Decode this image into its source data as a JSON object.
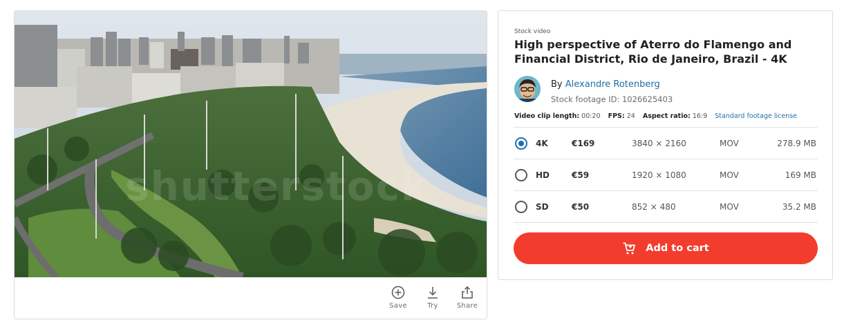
{
  "media": {
    "watermark": "shutterstock",
    "actions": [
      {
        "label": "Save",
        "icon": "add-circle-icon"
      },
      {
        "label": "Try",
        "icon": "download-icon"
      },
      {
        "label": "Share",
        "icon": "share-icon"
      }
    ]
  },
  "details": {
    "eyebrow": "Stock video",
    "title": "High perspective of Aterro do Flamengo and Financial District, Rio de Janeiro, Brazil - 4K",
    "by_prefix": "By",
    "author": "Alexandre Rotenberg",
    "footage_id": "Stock footage ID: 1026625403",
    "meta": {
      "length_label": "Video clip length:",
      "length_value": "00:20",
      "fps_label": "FPS:",
      "fps_value": "24",
      "aspect_label": "Aspect ratio:",
      "aspect_value": "16:9",
      "license_link": "Standard footage license"
    }
  },
  "options": [
    {
      "name": "4K",
      "price": "€169",
      "resolution": "3840 × 2160",
      "format": "MOV",
      "size": "278.9 MB",
      "selected": true
    },
    {
      "name": "HD",
      "price": "€59",
      "resolution": "1920 × 1080",
      "format": "MOV",
      "size": "169 MB",
      "selected": false
    },
    {
      "name": "SD",
      "price": "€50",
      "resolution": "852 × 480",
      "format": "MOV",
      "size": "35.2 MB",
      "selected": false
    }
  ],
  "cart": {
    "label": "Add to cart",
    "icon": "cart-icon"
  },
  "colors": {
    "accent": "#f23d2e",
    "link": "#1f6ea8",
    "radio_selected": "#1a6fb5"
  }
}
